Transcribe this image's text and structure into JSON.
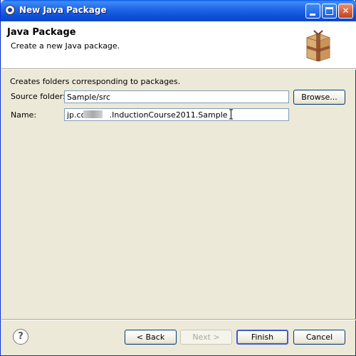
{
  "window": {
    "title": "New Java Package",
    "buttons": {
      "minimize": "_",
      "maximize": "□",
      "close": "✕"
    }
  },
  "header": {
    "title": "Java Package",
    "description": "Create a new Java package.",
    "icon": "package-icon"
  },
  "info": "Creates folders corresponding to packages.",
  "form": {
    "source_folder": {
      "label": "Source folder:",
      "value": "Sample/src",
      "browse": "Browse..."
    },
    "name": {
      "label": "Name:",
      "value_prefix": "jp.co.",
      "value_suffix": ".InductionCourse2011.Sample"
    }
  },
  "footer": {
    "help": "?",
    "back": "< Back",
    "next": "Next >",
    "finish": "Finish",
    "cancel": "Cancel"
  },
  "colors": {
    "titlebar": "#0c47c8",
    "dialog_bg": "#ece9d8",
    "field_border": "#7f9db9",
    "package_brown": "#c8955a"
  }
}
